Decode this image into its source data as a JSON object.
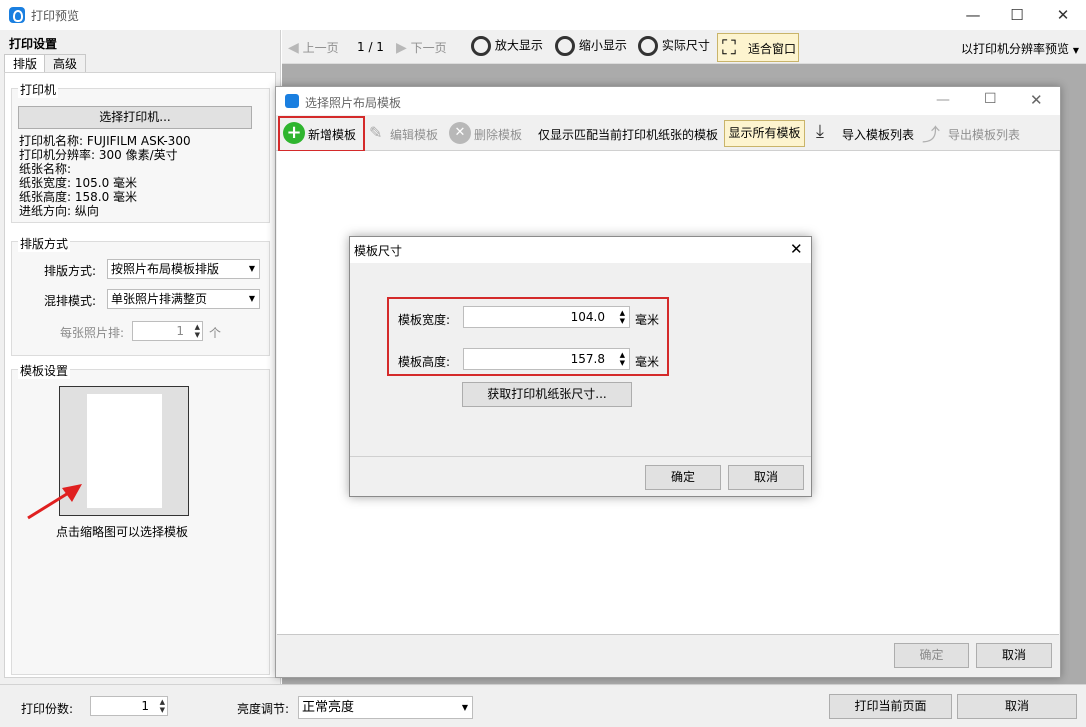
{
  "window": {
    "title": "打印预览",
    "min": "—",
    "max": "☐",
    "close": "✕"
  },
  "left_panel": {
    "heading": "打印设置",
    "tabs": [
      "排版",
      "高级"
    ],
    "printer_group": {
      "title": "打印机",
      "select_button": "选择打印机...",
      "lines": [
        "打印机名称: FUJIFILM ASK-300",
        "打印机分辨率: 300 像素/英寸",
        "纸张名称:",
        "纸张宽度: 105.0 毫米",
        "纸张高度: 158.0 毫米",
        "进纸方向: 纵向"
      ]
    },
    "layout_group": {
      "title": "排版方式",
      "layout_mode_label": "排版方式:",
      "layout_mode_value": "按照片布局模板排版",
      "mix_mode_label": "混排模式:",
      "mix_mode_value": "单张照片排满整页",
      "per_photo_label": "每张照片排:",
      "per_photo_value": "1",
      "per_photo_unit": "个"
    },
    "template_group": {
      "title": "模板设置",
      "hint": "点击缩略图可以选择模板"
    }
  },
  "preview_toolbar": {
    "prev": "上一页",
    "page": "1 / 1",
    "next": "下一页",
    "zoom_in": "放大显示",
    "zoom_out": "缩小显示",
    "actual_size": "实际尺寸",
    "fit_window": "适合窗口",
    "resolution_preview": "以打印机分辨率预览"
  },
  "bottom_bar": {
    "copies_label": "打印份数:",
    "copies_value": "1",
    "brightness_label": "亮度调节:",
    "brightness_value": "正常亮度",
    "print_button": "打印当前页面",
    "cancel_button": "取消"
  },
  "layout_dialog": {
    "title": "选择照片布局模板",
    "new_template": "新增模板",
    "edit_template": "编辑模板",
    "delete_template": "删除模板",
    "match_only": "仅显示匹配当前打印机纸张的模板",
    "show_all": "显示所有模板",
    "import": "导入模板列表",
    "export": "导出模板列表",
    "ok": "确定",
    "cancel": "取消"
  },
  "size_dialog": {
    "title": "模板尺寸",
    "width_label": "模板宽度:",
    "width_value": "104.0",
    "height_label": "模板高度:",
    "height_value": "157.8",
    "unit": "毫米",
    "get_paper_size": "获取打印机纸张尺寸...",
    "ok": "确定",
    "cancel": "取消"
  },
  "colors": {
    "accent_red": "#d42a2a",
    "arrow_red": "#e02020",
    "icon_green": "#2fb52f",
    "app_blue": "#1a7fe0"
  }
}
